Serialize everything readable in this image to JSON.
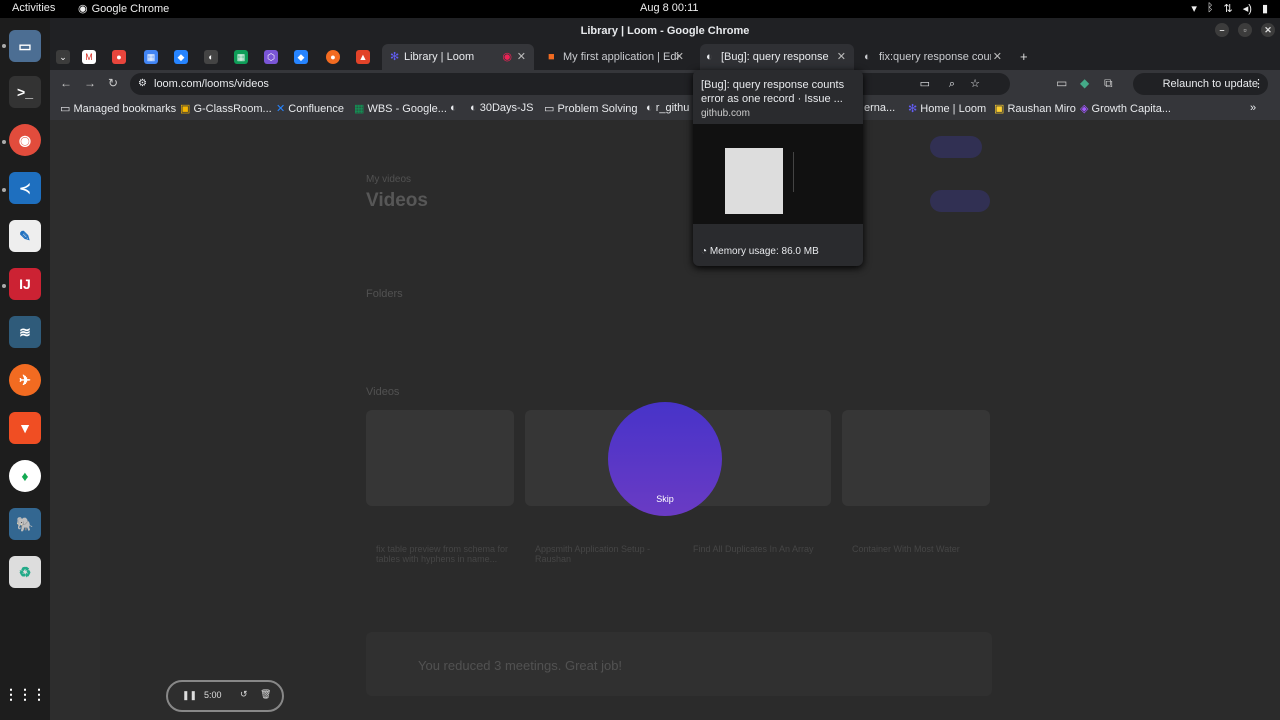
{
  "system": {
    "activities": "Activities",
    "app_name": "Google Chrome",
    "clock": "Aug 8  00:11"
  },
  "window": {
    "title": "Library | Loom - Google Chrome"
  },
  "tabs": [
    {
      "label": "Library | Loom"
    },
    {
      "label": "My first application | Edi"
    },
    {
      "label": "[Bug]: query response co"
    },
    {
      "label": "fix:query response count"
    }
  ],
  "address": {
    "url": "loom.com/looms/videos",
    "relaunch": "Relaunch to update"
  },
  "bookmarks": [
    {
      "label": "Managed bookmarks"
    },
    {
      "label": "G-ClassRoom..."
    },
    {
      "label": "Confluence"
    },
    {
      "label": "WBS - Google..."
    },
    {
      "label": "30Days-JS"
    },
    {
      "label": "Problem Solving"
    },
    {
      "label": "r_githu"
    },
    {
      "label": "erna..."
    },
    {
      "label": "Home | Loom"
    },
    {
      "label": "Raushan Miro"
    },
    {
      "label": "Growth Capita..."
    }
  ],
  "tooltip": {
    "title": "[Bug]: query response counts error as one record · Issue ...",
    "domain": "github.com",
    "memory": "Memory usage: 86.0 MB"
  },
  "loom": {
    "section": "My videos",
    "heading": "Videos",
    "folders_label": "Folders",
    "videos_label": "Videos",
    "skip_label": "Skip",
    "timer": "5:00",
    "banner": "You reduced 3 meetings. Great job!",
    "video_titles": [
      "fix table preview from schema for tables with hyphens in name...",
      "Appsmith Application Setup - Raushan",
      "Find All Duplicates In An Array",
      "Container With Most Water"
    ]
  },
  "colors": {
    "orb_top": "#4733c9",
    "orb_bottom": "#6a3bc4"
  }
}
